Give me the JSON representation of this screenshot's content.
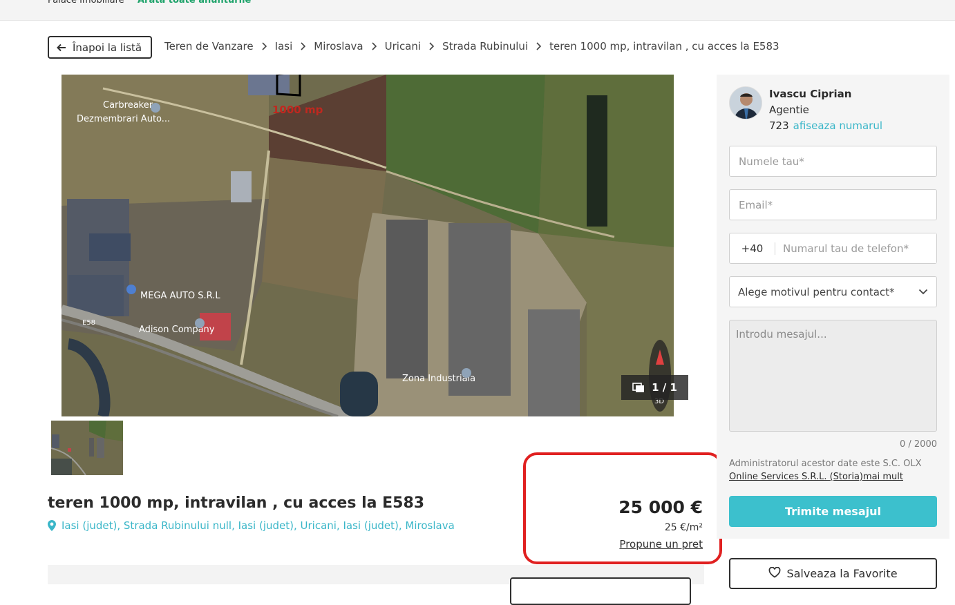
{
  "topbar": {
    "agency": "Palace Imobiliare",
    "all_ads": "Arata toate anunturile"
  },
  "back_label": "Înapoi la listă",
  "breadcrumb": [
    "Teren de Vanzare",
    "Iasi",
    "Miroslava",
    "Uricani",
    "Strada Rubinului",
    "teren 1000 mp, intravilan , cu acces la E583"
  ],
  "gallery": {
    "counter": "1 / 1",
    "map_labels": {
      "plot": "1000 mp",
      "business1": "Carbreaker - Dezmembrari Auto...",
      "business2": "MEGA AUTO S.R.L",
      "business3": "Adison Company",
      "zone": "Zona Industriala",
      "road": "E58"
    }
  },
  "listing": {
    "title": "teren 1000 mp, intravilan , cu acces la E583",
    "location": "Iasi (judet), Strada Rubinului null, Iasi (judet), Uricani, Iasi (judet), Miroslava"
  },
  "price": {
    "main": "25 000 €",
    "per_sqm": "25 €/m²",
    "offer_link": "Propune un pret"
  },
  "agent": {
    "name": "Ivascu Ciprian",
    "role": "Agentie",
    "phone_prefix": "723",
    "show_number": "afiseaza numarul"
  },
  "form": {
    "name_placeholder": "Numele tau*",
    "email_placeholder": "Email*",
    "phone_prefix": "+40",
    "phone_placeholder": "Numarul tau de telefon*",
    "reason_placeholder": "Alege motivul pentru contact*",
    "message_placeholder": "Introdu mesajul...",
    "char_counter": "0 / 2000",
    "admin_note": "Administratorul acestor date este S.C. OLX",
    "admin_link": "Online Services S.R.L. (Storia)mai mult",
    "submit_label": "Trimite mesajul"
  },
  "favorite_label": "Salveaza la Favorite",
  "colors": {
    "accent": "#3cc0cd",
    "link": "#3ab6c8",
    "highlight": "#e02020"
  }
}
